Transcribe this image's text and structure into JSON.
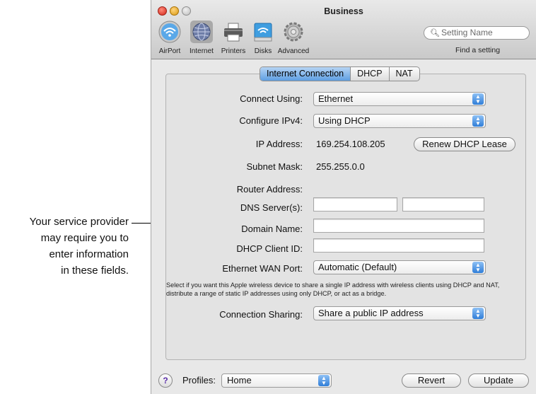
{
  "callout": {
    "lines": [
      "Your service provider",
      "may require you to",
      "enter information",
      "in these fields."
    ]
  },
  "window": {
    "title": "Business",
    "toolbar": [
      {
        "label": "AirPort",
        "icon": "airport-icon"
      },
      {
        "label": "Internet",
        "icon": "internet-globe-icon"
      },
      {
        "label": "Printers",
        "icon": "printer-icon"
      },
      {
        "label": "Disks",
        "icon": "disk-icon"
      },
      {
        "label": "Advanced",
        "icon": "gear-icon"
      }
    ],
    "search": {
      "placeholder": "Setting Name",
      "caption": "Find a setting"
    }
  },
  "tabs": [
    "Internet Connection",
    "DHCP",
    "NAT"
  ],
  "form": {
    "connect_using": {
      "label": "Connect Using:",
      "value": "Ethernet"
    },
    "configure_ipv4": {
      "label": "Configure IPv4:",
      "value": "Using DHCP"
    },
    "ip_address": {
      "label": "IP Address:",
      "value": "169.254.108.205"
    },
    "renew_button": "Renew DHCP Lease",
    "subnet_mask": {
      "label": "Subnet Mask:",
      "value": "255.255.0.0"
    },
    "router_address": {
      "label": "Router Address:",
      "value": ""
    },
    "dns_servers": {
      "label": "DNS Server(s):",
      "value1": "",
      "value2": ""
    },
    "domain_name": {
      "label": "Domain Name:",
      "value": ""
    },
    "dhcp_client_id": {
      "label": "DHCP Client ID:",
      "value": ""
    },
    "ethernet_wan_port": {
      "label": "Ethernet WAN Port:",
      "value": "Automatic (Default)"
    },
    "description": "Select if you want this Apple wireless device to share a single IP address with wireless clients using DHCP and NAT, distribute a range of static IP addresses using only DHCP, or act as a bridge.",
    "connection_sharing": {
      "label": "Connection Sharing:",
      "value": "Share a public IP address"
    }
  },
  "footer": {
    "help": "?",
    "profiles_label": "Profiles:",
    "profiles_value": "Home",
    "revert": "Revert",
    "update": "Update"
  },
  "colors": {
    "accent_tab": "#5e9ee2",
    "stepper": "#2f7ed8"
  }
}
